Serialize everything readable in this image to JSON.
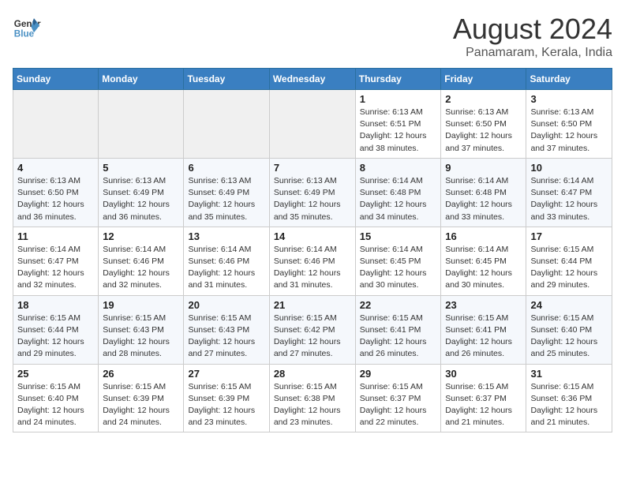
{
  "header": {
    "logo_line1": "General",
    "logo_line2": "Blue",
    "title": "August 2024",
    "subtitle": "Panamaram, Kerala, India"
  },
  "calendar": {
    "days_of_week": [
      "Sunday",
      "Monday",
      "Tuesday",
      "Wednesday",
      "Thursday",
      "Friday",
      "Saturday"
    ],
    "weeks": [
      [
        {
          "day": "",
          "info": ""
        },
        {
          "day": "",
          "info": ""
        },
        {
          "day": "",
          "info": ""
        },
        {
          "day": "",
          "info": ""
        },
        {
          "day": "1",
          "info": "Sunrise: 6:13 AM\nSunset: 6:51 PM\nDaylight: 12 hours\nand 38 minutes."
        },
        {
          "day": "2",
          "info": "Sunrise: 6:13 AM\nSunset: 6:50 PM\nDaylight: 12 hours\nand 37 minutes."
        },
        {
          "day": "3",
          "info": "Sunrise: 6:13 AM\nSunset: 6:50 PM\nDaylight: 12 hours\nand 37 minutes."
        }
      ],
      [
        {
          "day": "4",
          "info": "Sunrise: 6:13 AM\nSunset: 6:50 PM\nDaylight: 12 hours\nand 36 minutes."
        },
        {
          "day": "5",
          "info": "Sunrise: 6:13 AM\nSunset: 6:49 PM\nDaylight: 12 hours\nand 36 minutes."
        },
        {
          "day": "6",
          "info": "Sunrise: 6:13 AM\nSunset: 6:49 PM\nDaylight: 12 hours\nand 35 minutes."
        },
        {
          "day": "7",
          "info": "Sunrise: 6:13 AM\nSunset: 6:49 PM\nDaylight: 12 hours\nand 35 minutes."
        },
        {
          "day": "8",
          "info": "Sunrise: 6:14 AM\nSunset: 6:48 PM\nDaylight: 12 hours\nand 34 minutes."
        },
        {
          "day": "9",
          "info": "Sunrise: 6:14 AM\nSunset: 6:48 PM\nDaylight: 12 hours\nand 33 minutes."
        },
        {
          "day": "10",
          "info": "Sunrise: 6:14 AM\nSunset: 6:47 PM\nDaylight: 12 hours\nand 33 minutes."
        }
      ],
      [
        {
          "day": "11",
          "info": "Sunrise: 6:14 AM\nSunset: 6:47 PM\nDaylight: 12 hours\nand 32 minutes."
        },
        {
          "day": "12",
          "info": "Sunrise: 6:14 AM\nSunset: 6:46 PM\nDaylight: 12 hours\nand 32 minutes."
        },
        {
          "day": "13",
          "info": "Sunrise: 6:14 AM\nSunset: 6:46 PM\nDaylight: 12 hours\nand 31 minutes."
        },
        {
          "day": "14",
          "info": "Sunrise: 6:14 AM\nSunset: 6:46 PM\nDaylight: 12 hours\nand 31 minutes."
        },
        {
          "day": "15",
          "info": "Sunrise: 6:14 AM\nSunset: 6:45 PM\nDaylight: 12 hours\nand 30 minutes."
        },
        {
          "day": "16",
          "info": "Sunrise: 6:14 AM\nSunset: 6:45 PM\nDaylight: 12 hours\nand 30 minutes."
        },
        {
          "day": "17",
          "info": "Sunrise: 6:15 AM\nSunset: 6:44 PM\nDaylight: 12 hours\nand 29 minutes."
        }
      ],
      [
        {
          "day": "18",
          "info": "Sunrise: 6:15 AM\nSunset: 6:44 PM\nDaylight: 12 hours\nand 29 minutes."
        },
        {
          "day": "19",
          "info": "Sunrise: 6:15 AM\nSunset: 6:43 PM\nDaylight: 12 hours\nand 28 minutes."
        },
        {
          "day": "20",
          "info": "Sunrise: 6:15 AM\nSunset: 6:43 PM\nDaylight: 12 hours\nand 27 minutes."
        },
        {
          "day": "21",
          "info": "Sunrise: 6:15 AM\nSunset: 6:42 PM\nDaylight: 12 hours\nand 27 minutes."
        },
        {
          "day": "22",
          "info": "Sunrise: 6:15 AM\nSunset: 6:41 PM\nDaylight: 12 hours\nand 26 minutes."
        },
        {
          "day": "23",
          "info": "Sunrise: 6:15 AM\nSunset: 6:41 PM\nDaylight: 12 hours\nand 26 minutes."
        },
        {
          "day": "24",
          "info": "Sunrise: 6:15 AM\nSunset: 6:40 PM\nDaylight: 12 hours\nand 25 minutes."
        }
      ],
      [
        {
          "day": "25",
          "info": "Sunrise: 6:15 AM\nSunset: 6:40 PM\nDaylight: 12 hours\nand 24 minutes."
        },
        {
          "day": "26",
          "info": "Sunrise: 6:15 AM\nSunset: 6:39 PM\nDaylight: 12 hours\nand 24 minutes."
        },
        {
          "day": "27",
          "info": "Sunrise: 6:15 AM\nSunset: 6:39 PM\nDaylight: 12 hours\nand 23 minutes."
        },
        {
          "day": "28",
          "info": "Sunrise: 6:15 AM\nSunset: 6:38 PM\nDaylight: 12 hours\nand 23 minutes."
        },
        {
          "day": "29",
          "info": "Sunrise: 6:15 AM\nSunset: 6:37 PM\nDaylight: 12 hours\nand 22 minutes."
        },
        {
          "day": "30",
          "info": "Sunrise: 6:15 AM\nSunset: 6:37 PM\nDaylight: 12 hours\nand 21 minutes."
        },
        {
          "day": "31",
          "info": "Sunrise: 6:15 AM\nSunset: 6:36 PM\nDaylight: 12 hours\nand 21 minutes."
        }
      ]
    ]
  }
}
